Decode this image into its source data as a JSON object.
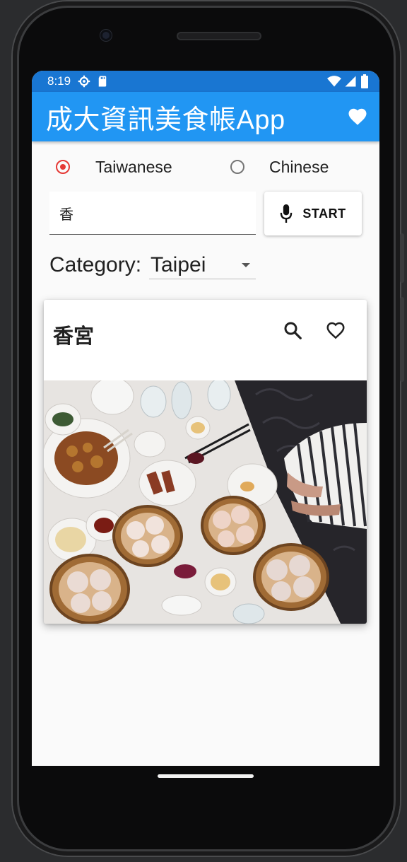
{
  "status_bar": {
    "time": "8:19",
    "icons": [
      "settings-gear-icon",
      "sd-card-icon",
      "wifi-icon",
      "signal-icon",
      "battery-icon"
    ]
  },
  "app_bar": {
    "title": "成大資訊美食帳App",
    "action_icon": "heart-filled-icon",
    "color": "#2196f3",
    "status_color": "#1976d2"
  },
  "language": {
    "options": [
      {
        "label": "Taiwanese",
        "selected": true
      },
      {
        "label": "Chinese",
        "selected": false
      }
    ],
    "accent": "#e53935"
  },
  "search": {
    "value": "香",
    "placeholder": ""
  },
  "voice_button": {
    "label": "START",
    "icon": "microphone-icon"
  },
  "category": {
    "label": "Category:",
    "selected": "Taipei"
  },
  "result_card": {
    "title": "香宮",
    "actions": [
      "search-icon",
      "heart-outline-icon"
    ],
    "image": "dim-sum-table-photo"
  }
}
